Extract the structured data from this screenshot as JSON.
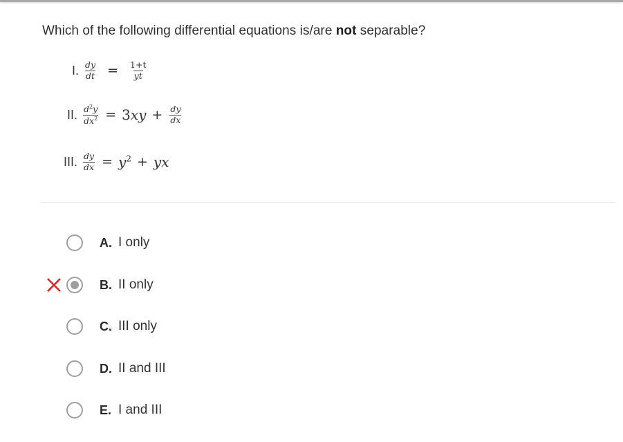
{
  "question": {
    "prefix": "Which of the following differential equations is/are ",
    "emphasis": "not",
    "suffix": " separable?"
  },
  "equations": [
    {
      "numeral": "I.",
      "lhs_num": "dy",
      "lhs_den": "dt",
      "equals": "=",
      "rhs_num": "1+t",
      "rhs_den": "yt"
    },
    {
      "numeral": "II.",
      "lhs_num_base": "d",
      "lhs_num_sup": "2",
      "lhs_num_var": "y",
      "lhs_den_base": "dx",
      "lhs_den_sup": "2",
      "equals": "=",
      "rhs_coef": "3",
      "rhs_term": "xy",
      "plus": "+",
      "rhs_frac_num": "dy",
      "rhs_frac_den": "dx"
    },
    {
      "numeral": "III.",
      "lhs_num": "dy",
      "lhs_den": "dx",
      "equals": "=",
      "rhs_term1": "y",
      "rhs_term1_sup": "2",
      "plus": "+",
      "rhs_term2": "yx"
    }
  ],
  "choices": [
    {
      "letter": "A.",
      "text": "I only",
      "selected": false
    },
    {
      "letter": "B.",
      "text": "II only",
      "selected": true,
      "marked_incorrect": true
    },
    {
      "letter": "C.",
      "text": "III only",
      "selected": false
    },
    {
      "letter": "D.",
      "text": "II and III",
      "selected": false
    },
    {
      "letter": "E.",
      "text": "I and III",
      "selected": false
    }
  ],
  "icons": {
    "incorrect": "x-mark-icon",
    "radio": "radio-button-icon"
  },
  "colors": {
    "incorrect": "#e02020",
    "radio": "#9e9e9e",
    "divider": "#e3e3e3"
  }
}
